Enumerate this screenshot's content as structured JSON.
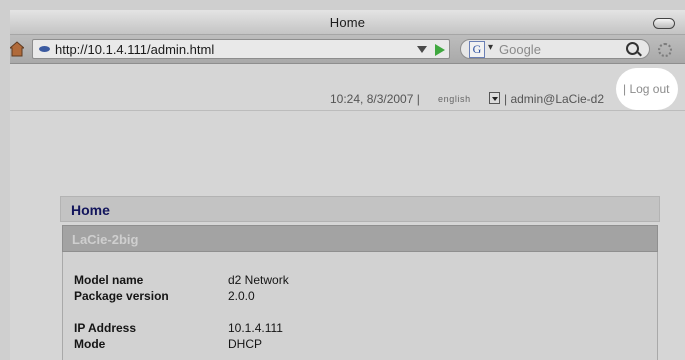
{
  "window": {
    "title": "Home"
  },
  "toolbar": {
    "url": "http://10.1.4.111/admin.html",
    "search_engine_letter": "G",
    "search_placeholder": "Google"
  },
  "status": {
    "time_date": "10:24, 8/3/2007 |",
    "language": "english",
    "user": "| admin@LaCie-d2",
    "logout": "| Log out"
  },
  "main": {
    "section_title": "Home",
    "device_name": "LaCie-2big",
    "info": [
      {
        "label": "Model name",
        "value": "d2 Network"
      },
      {
        "label": "Package version",
        "value": "2.0.0"
      },
      {
        "label": "IP Address",
        "value": "10.1.4.111"
      },
      {
        "label": "Mode",
        "value": "DHCP"
      }
    ]
  }
}
